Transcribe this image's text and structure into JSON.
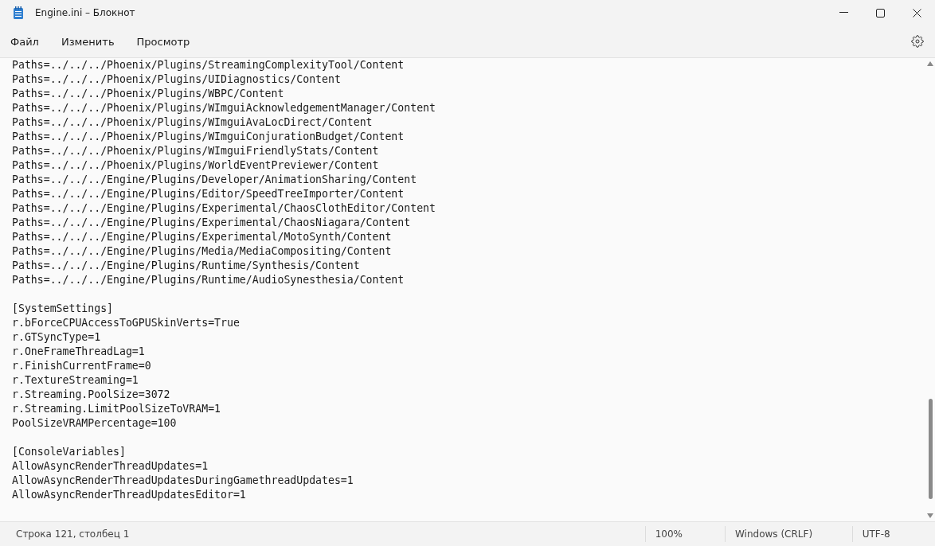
{
  "window": {
    "title": "Engine.ini – Блокнот"
  },
  "menu": [
    {
      "label": "Файл"
    },
    {
      "label": "Изменить"
    },
    {
      "label": "Просмотр"
    }
  ],
  "editor": {
    "blocks": [
      {
        "lines": [
          "Paths=../../../Phoenix/Plugins/StreamingComplexityTool/Content",
          "Paths=../../../Phoenix/Plugins/UIDiagnostics/Content",
          "Paths=../../../Phoenix/Plugins/WBPC/Content",
          "Paths=../../../Phoenix/Plugins/WImguiAcknowledgementManager/Content",
          "Paths=../../../Phoenix/Plugins/WImguiAvaLocDirect/Content",
          "Paths=../../../Phoenix/Plugins/WImguiConjurationBudget/Content",
          "Paths=../../../Phoenix/Plugins/WImguiFriendlyStats/Content",
          "Paths=../../../Phoenix/Plugins/WorldEventPreviewer/Content",
          "Paths=../../../Engine/Plugins/Developer/AnimationSharing/Content",
          "Paths=../../../Engine/Plugins/Editor/SpeedTreeImporter/Content",
          "Paths=../../../Engine/Plugins/Experimental/ChaosClothEditor/Content",
          "Paths=../../../Engine/Plugins/Experimental/ChaosNiagara/Content",
          "Paths=../../../Engine/Plugins/Experimental/MotoSynth/Content",
          "Paths=../../../Engine/Plugins/Media/MediaCompositing/Content",
          "Paths=../../../Engine/Plugins/Runtime/Synthesis/Content",
          "Paths=../../../Engine/Plugins/Runtime/AudioSynesthesia/Content"
        ]
      },
      {
        "lines": [
          "[SystemSettings]",
          "r.bForceCPUAccessToGPUSkinVerts=True",
          "r.GTSyncType=1",
          "r.OneFrameThreadLag=1",
          "r.FinishCurrentFrame=0",
          "r.TextureStreaming=1",
          "r.Streaming.PoolSize=3072",
          "r.Streaming.LimitPoolSizeToVRAM=1",
          "PoolSizeVRAMPercentage=100"
        ]
      },
      {
        "lines": [
          "[ConsoleVariables]",
          "AllowAsyncRenderThreadUpdates=1",
          "AllowAsyncRenderThreadUpdatesDuringGamethreadUpdates=1",
          "AllowAsyncRenderThreadUpdatesEditor=1"
        ]
      }
    ]
  },
  "status_bar": {
    "position": "Строка 121, столбец 1",
    "zoom": "100%",
    "line_endings": "Windows (CRLF)",
    "encoding": "UTF-8"
  }
}
